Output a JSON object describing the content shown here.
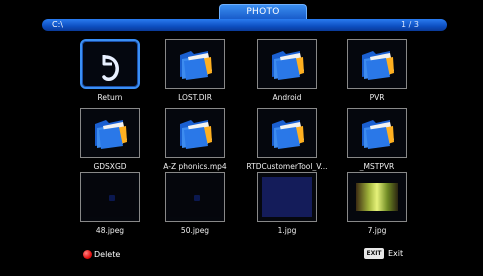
{
  "header": {
    "title": "PHOTO"
  },
  "path_bar": {
    "path": "C:\\",
    "page": "1 / 3"
  },
  "items": [
    {
      "label": "Return",
      "type": "return"
    },
    {
      "label": "LOST.DIR",
      "type": "folder"
    },
    {
      "label": "Android",
      "type": "folder"
    },
    {
      "label": "PVR",
      "type": "folder"
    },
    {
      "label": "GDSXGD",
      "type": "folder"
    },
    {
      "label": "A-Z phonics.mp4",
      "type": "folder"
    },
    {
      "label": "RTDCustomerTool_V...",
      "type": "folder"
    },
    {
      "label": "_MSTPVR",
      "type": "folder"
    },
    {
      "label": "48.jpeg",
      "type": "image-dark"
    },
    {
      "label": "50.jpeg",
      "type": "image-dark"
    },
    {
      "label": "1.jpg",
      "type": "image-navy"
    },
    {
      "label": "7.jpg",
      "type": "image-photo"
    }
  ],
  "footer": {
    "delete_label": "Delete",
    "exit_key": "EXIT",
    "exit_label": "Exit"
  },
  "colors": {
    "accent": "#1f6fe0",
    "selection": "#3b8ff5",
    "delete": "#e01010"
  }
}
